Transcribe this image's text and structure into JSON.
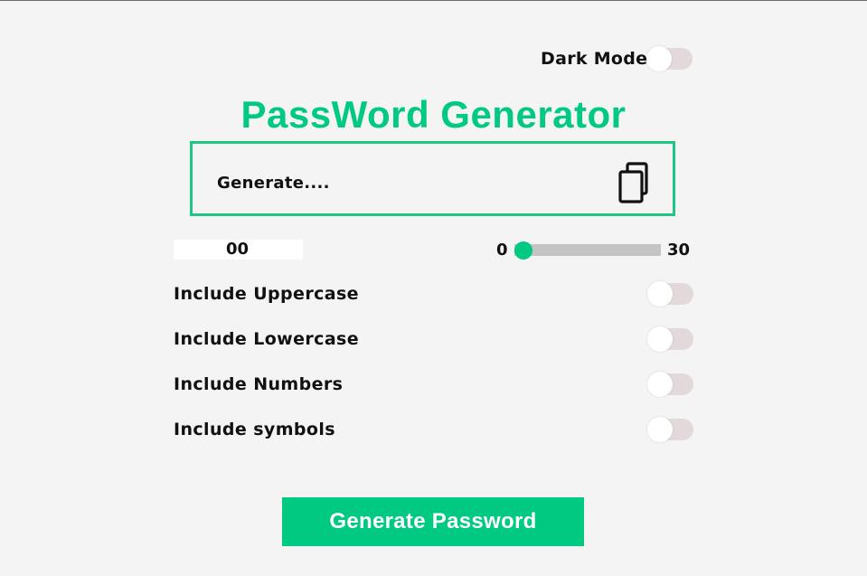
{
  "theme": {
    "accent": "#00c982",
    "toggle_track": "#e3d9da",
    "slider_track": "#c4c4c4",
    "background": "#f4f4f4"
  },
  "dark_mode": {
    "label": "Dark Mode",
    "on": false
  },
  "title": "PassWord Generator",
  "output": {
    "value": "Generate....",
    "copy_icon": "copy-icon"
  },
  "length": {
    "display": "00",
    "min_label": "0",
    "max_label": "30",
    "value": 0,
    "min": 0,
    "max": 30
  },
  "options": [
    {
      "label": "Include Uppercase",
      "on": false
    },
    {
      "label": "Include Lowercase",
      "on": false
    },
    {
      "label": "Include Numbers",
      "on": false
    },
    {
      "label": "Include symbols",
      "on": false
    }
  ],
  "generate_button": {
    "label": "Generate Password"
  }
}
